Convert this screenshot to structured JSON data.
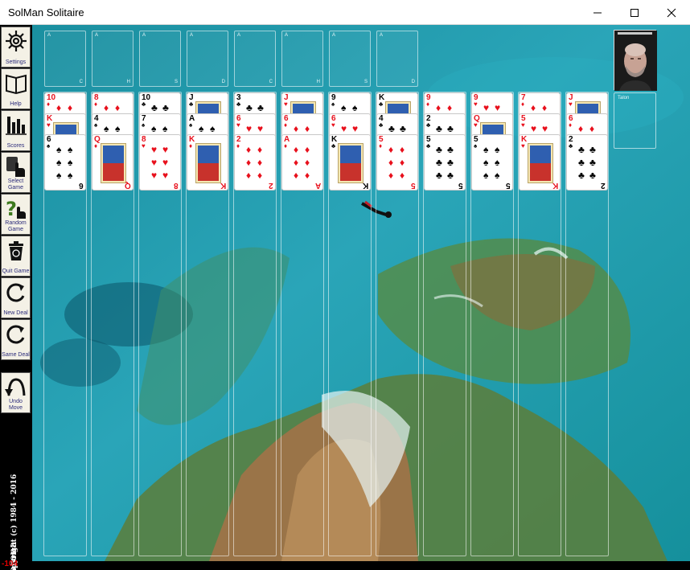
{
  "window": {
    "title": "SolMan Solitaire"
  },
  "sidebar": {
    "items": [
      {
        "id": "settings",
        "label": "Settings",
        "icon": "gear-icon"
      },
      {
        "id": "help",
        "label": "Help",
        "icon": "book-icon"
      },
      {
        "id": "scores",
        "label": "Scores",
        "icon": "bar-chart-icon"
      },
      {
        "id": "select-game",
        "label": "Select Game",
        "icon": "hand-pointer-icon"
      },
      {
        "id": "random-game",
        "label": "Random Game",
        "icon": "question-hand-icon"
      },
      {
        "id": "quit-game",
        "label": "Quit Game",
        "icon": "recycle-bin-icon"
      },
      {
        "id": "new-deal",
        "label": "New Deal",
        "icon": "redo-arrow-icon"
      },
      {
        "id": "same-deal",
        "label": "Same Deal",
        "icon": "redo-arrow-icon"
      },
      {
        "id": "undo-move",
        "label": "Undo Move",
        "icon": "undo-arrow-icon"
      }
    ],
    "copyright": "Copyright (c) 1984 - 2016",
    "company": "Corona",
    "score": "-104"
  },
  "foundations": [
    {
      "base": "A",
      "suit": "C"
    },
    {
      "base": "A",
      "suit": "H"
    },
    {
      "base": "A",
      "suit": "S"
    },
    {
      "base": "A",
      "suit": "D"
    },
    {
      "base": "A",
      "suit": "C"
    },
    {
      "base": "A",
      "suit": "H"
    },
    {
      "base": "A",
      "suit": "S"
    },
    {
      "base": "A",
      "suit": "D"
    }
  ],
  "tableau": [
    [
      {
        "rank": "10",
        "suit": "♦",
        "color": "red"
      },
      {
        "rank": "K",
        "suit": "♥",
        "color": "red"
      },
      {
        "rank": "6",
        "suit": "♠",
        "color": "black"
      }
    ],
    [
      {
        "rank": "8",
        "suit": "♦",
        "color": "red"
      },
      {
        "rank": "4",
        "suit": "♠",
        "color": "black"
      },
      {
        "rank": "Q",
        "suit": "♦",
        "color": "red"
      }
    ],
    [
      {
        "rank": "10",
        "suit": "♣",
        "color": "black"
      },
      {
        "rank": "7",
        "suit": "♠",
        "color": "black"
      },
      {
        "rank": "8",
        "suit": "♥",
        "color": "red"
      }
    ],
    [
      {
        "rank": "J",
        "suit": "♣",
        "color": "black"
      },
      {
        "rank": "A",
        "suit": "♠",
        "color": "black"
      },
      {
        "rank": "K",
        "suit": "♦",
        "color": "red"
      }
    ],
    [
      {
        "rank": "3",
        "suit": "♣",
        "color": "black"
      },
      {
        "rank": "6",
        "suit": "♥",
        "color": "red"
      },
      {
        "rank": "2",
        "suit": "♦",
        "color": "red"
      }
    ],
    [
      {
        "rank": "J",
        "suit": "♥",
        "color": "red"
      },
      {
        "rank": "6",
        "suit": "♦",
        "color": "red"
      },
      {
        "rank": "A",
        "suit": "♦",
        "color": "red"
      }
    ],
    [
      {
        "rank": "9",
        "suit": "♠",
        "color": "black"
      },
      {
        "rank": "6",
        "suit": "♥",
        "color": "red"
      },
      {
        "rank": "K",
        "suit": "♣",
        "color": "black"
      }
    ],
    [
      {
        "rank": "K",
        "suit": "♣",
        "color": "black"
      },
      {
        "rank": "4",
        "suit": "♣",
        "color": "black"
      },
      {
        "rank": "5",
        "suit": "♦",
        "color": "red"
      }
    ],
    [
      {
        "rank": "9",
        "suit": "♦",
        "color": "red"
      },
      {
        "rank": "2",
        "suit": "♣",
        "color": "black"
      },
      {
        "rank": "5",
        "suit": "♣",
        "color": "black"
      }
    ],
    [
      {
        "rank": "9",
        "suit": "♥",
        "color": "red"
      },
      {
        "rank": "Q",
        "suit": "♥",
        "color": "red"
      },
      {
        "rank": "5",
        "suit": "♠",
        "color": "black"
      }
    ],
    [
      {
        "rank": "7",
        "suit": "♦",
        "color": "red"
      },
      {
        "rank": "5",
        "suit": "♥",
        "color": "red"
      },
      {
        "rank": "K",
        "suit": "♥",
        "color": "red"
      }
    ],
    [
      {
        "rank": "J",
        "suit": "♥",
        "color": "red"
      },
      {
        "rank": "6",
        "suit": "♦",
        "color": "red"
      },
      {
        "rank": "2",
        "suit": "♣",
        "color": "black"
      }
    ]
  ],
  "player": {
    "slot_label": "Talon"
  },
  "colors": {
    "red_suit": "#e8101c",
    "black_suit": "#000000",
    "felt": "#1f93a4"
  }
}
